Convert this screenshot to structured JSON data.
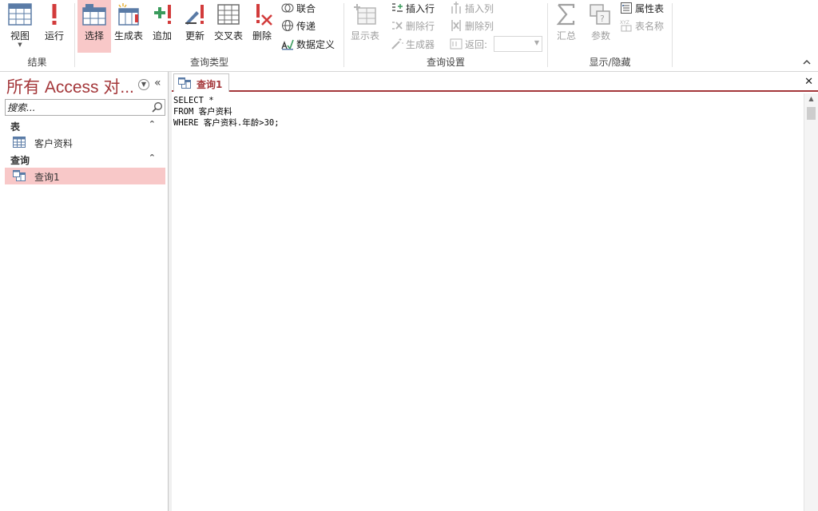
{
  "ribbon": {
    "results": {
      "label": "结果",
      "view": "视图",
      "run": "运行"
    },
    "query_type": {
      "label": "查询类型",
      "select": "选择",
      "make_table": "生成表",
      "append": "追加",
      "update": "更新",
      "crosstab": "交叉表",
      "delete": "删除",
      "union": "联合",
      "pass_through": "传递",
      "data_definition": "数据定义"
    },
    "query_setup": {
      "label": "查询设置",
      "show_table": "显示表",
      "insert_rows": "插入行",
      "delete_rows": "删除行",
      "builder": "生成器",
      "insert_columns": "插入列",
      "delete_columns": "删除列",
      "return": "返回:",
      "return_value": ""
    },
    "show_hide": {
      "label": "显示/隐藏",
      "totals": "汇总",
      "parameters": "参数",
      "property_sheet": "属性表",
      "table_names": "表名称"
    }
  },
  "nav": {
    "title": "所有 Access 对...",
    "search_placeholder": "搜索...",
    "sections": [
      {
        "label": "表",
        "items": [
          {
            "label": "客户资料"
          }
        ]
      },
      {
        "label": "查询",
        "items": [
          {
            "label": "查询1"
          }
        ]
      }
    ]
  },
  "document": {
    "tab_label": "查询1",
    "sql": "SELECT *\nFROM 客户资料\nWHERE 客户资料.年龄>30;"
  },
  "colors": {
    "accent": "#a4373a",
    "selected_bg": "#f8c8c8"
  }
}
